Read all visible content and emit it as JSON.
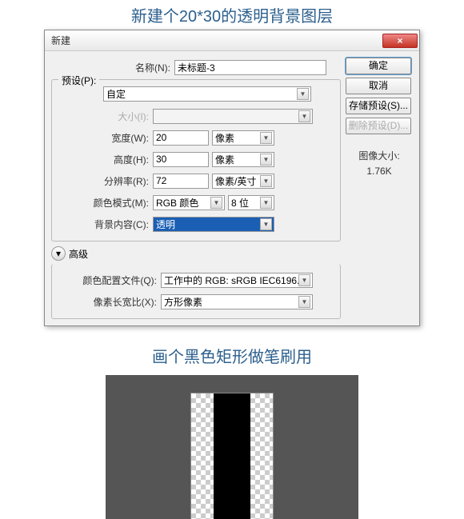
{
  "caption1": "新建个20*30的透明背景图层",
  "dialog": {
    "title": "新建",
    "close": "×",
    "name_lbl": "名称(N):",
    "name_val": "未标题-3",
    "preset_lbl": "预设(P):",
    "preset_val": "自定",
    "size_lbl": "大小(I):",
    "width_lbl": "宽度(W):",
    "width_val": "20",
    "width_unit": "像素",
    "height_lbl": "高度(H):",
    "height_val": "30",
    "height_unit": "像素",
    "res_lbl": "分辨率(R):",
    "res_val": "72",
    "res_unit": "像素/英寸",
    "mode_lbl": "颜色模式(M):",
    "mode_val": "RGB 颜色",
    "mode_bits": "8 位",
    "bg_lbl": "背景内容(C):",
    "bg_val": "透明",
    "adv_lbl": "高级",
    "profile_lbl": "颜色配置文件(Q):",
    "profile_val": "工作中的 RGB: sRGB IEC6196...",
    "aspect_lbl": "像素长宽比(X):",
    "aspect_val": "方形像素",
    "imgsize_lbl": "图像大小:",
    "imgsize_val": "1.76K",
    "btn_ok": "确定",
    "btn_cancel": "取消",
    "btn_save": "存储预设(S)...",
    "btn_delete": "删除预设(D)..."
  },
  "caption2": "画个黑色矩形做笔刷用"
}
